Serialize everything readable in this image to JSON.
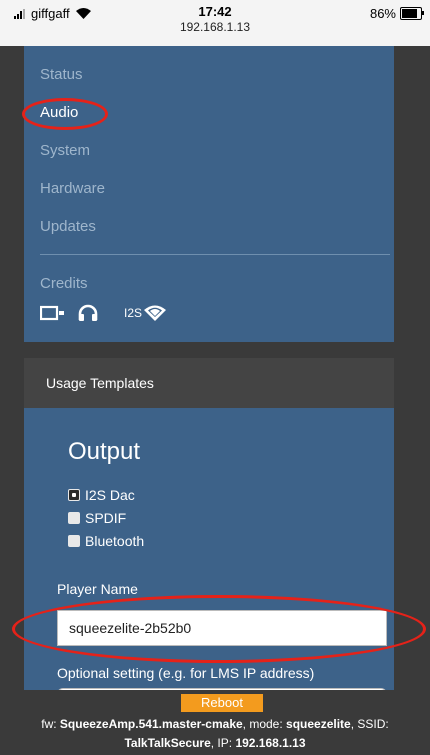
{
  "status_bar": {
    "carrier": "giffgaff",
    "time": "17:42",
    "url": "192.168.1.13",
    "battery": "86%",
    "battery_level": 0.86
  },
  "menu": {
    "items": [
      {
        "label": "Status",
        "active": false
      },
      {
        "label": "Audio",
        "active": true
      },
      {
        "label": "System",
        "active": false
      },
      {
        "label": "Hardware",
        "active": false
      },
      {
        "label": "Updates",
        "active": false
      }
    ],
    "credits": "Credits",
    "i2s_label": "I2S"
  },
  "card": {
    "header": "Usage Templates",
    "output_title": "Output",
    "options": [
      {
        "label": "I2S Dac",
        "checked": true
      },
      {
        "label": "SPDIF",
        "checked": false
      },
      {
        "label": "Bluetooth",
        "checked": false
      }
    ],
    "player_name_label": "Player Name",
    "player_name_value": "squeezelite-2b52b0",
    "optional_label": "Optional setting (e.g. for LMS IP address)"
  },
  "footer": {
    "reboot_label": "Reboot",
    "fw_prefix": "fw: ",
    "fw_value": "SqueezeAmp.541.master-cmake",
    "mode_prefix": ", mode: ",
    "mode_value": "squeezelite",
    "ssid_prefix": ", SSID:",
    "ssid_value": "TalkTalkSecure",
    "ip_prefix": ", IP: ",
    "ip_value": "192.168.1.13"
  },
  "colors": {
    "panel": "#3d6289",
    "header": "#444444",
    "accent_orange": "#f39b1e",
    "annotation_red": "#e52219"
  }
}
